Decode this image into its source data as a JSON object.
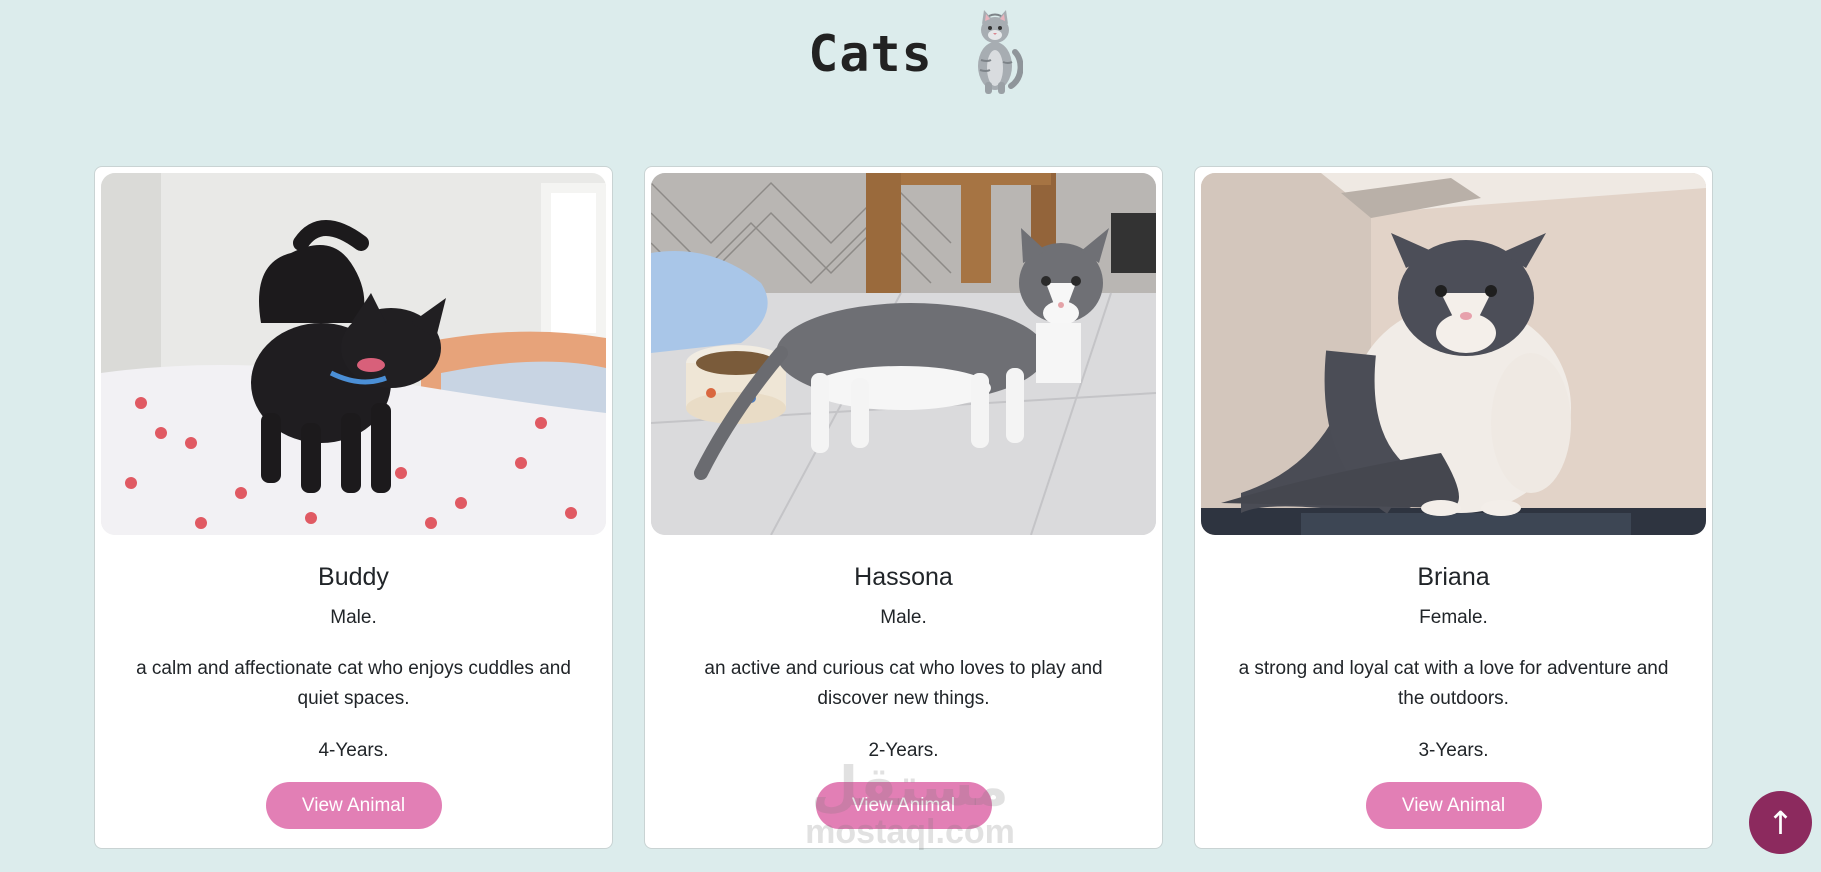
{
  "header": {
    "title": "Cats",
    "icon": "cat-illustration-icon"
  },
  "cards": [
    {
      "photo": "black-kitten-photo",
      "name": "Buddy",
      "gender": "Male.",
      "description": "a calm and affectionate cat who enjoys cuddles and quiet spaces.",
      "age": "4-Years.",
      "button_label": "View Animal"
    },
    {
      "photo": "gray-white-cat-photo",
      "name": "Hassona",
      "gender": "Male.",
      "description": "an active and curious cat who loves to play and discover new things.",
      "age": "2-Years.",
      "button_label": "View Animal"
    },
    {
      "photo": "gray-white-sitting-cat-photo",
      "name": "Briana",
      "gender": "Female.",
      "description": "a strong and loyal cat with a love for adventure and the outdoors.",
      "age": "3-Years.",
      "button_label": "View Animal"
    }
  ],
  "watermark": {
    "arabic": "مستقل",
    "latin": "mostaql.com"
  },
  "scroll_top": {
    "icon": "arrow-up-icon",
    "glyph": "↑"
  },
  "colors": {
    "background": "#dcecec",
    "button": "#e27fb5",
    "scroll_top": "#8c2a5e"
  }
}
